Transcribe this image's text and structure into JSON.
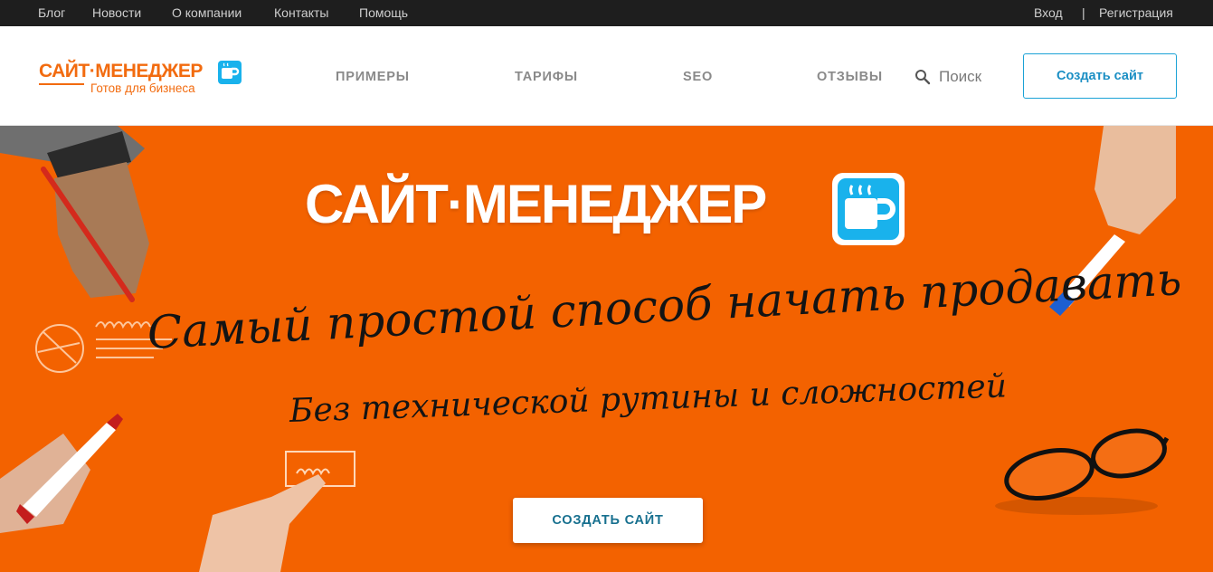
{
  "topbar": {
    "links": [
      "Блог",
      "Новости",
      "О компании",
      "Контакты",
      "Помощь"
    ],
    "login": "Вход",
    "separator": "|",
    "register": "Регистрация"
  },
  "header": {
    "logo_text": "САЙТ·МЕНЕДЖЕР",
    "logo_tagline": "Готов для бизнеса",
    "nav": [
      "ПРИМЕРЫ",
      "ТАРИФЫ",
      "SEO",
      "ОТЗЫВЫ"
    ],
    "search_label": "Поиск",
    "cta_label": "Создать сайт"
  },
  "hero": {
    "title": "САЙТ·МЕНЕДЖЕР",
    "slogan": "Самый простой способ начать продавать",
    "subtitle": "Без технической рутины и сложностей",
    "cta_label": "СОЗДАТЬ САЙТ",
    "background_color": "#f36200"
  },
  "colors": {
    "accent": "#f26b0f",
    "button_blue": "#1ba2d6",
    "badge_blue": "#19b2ec"
  },
  "icons": [
    "coffee-cup-p-icon",
    "search-icon"
  ]
}
